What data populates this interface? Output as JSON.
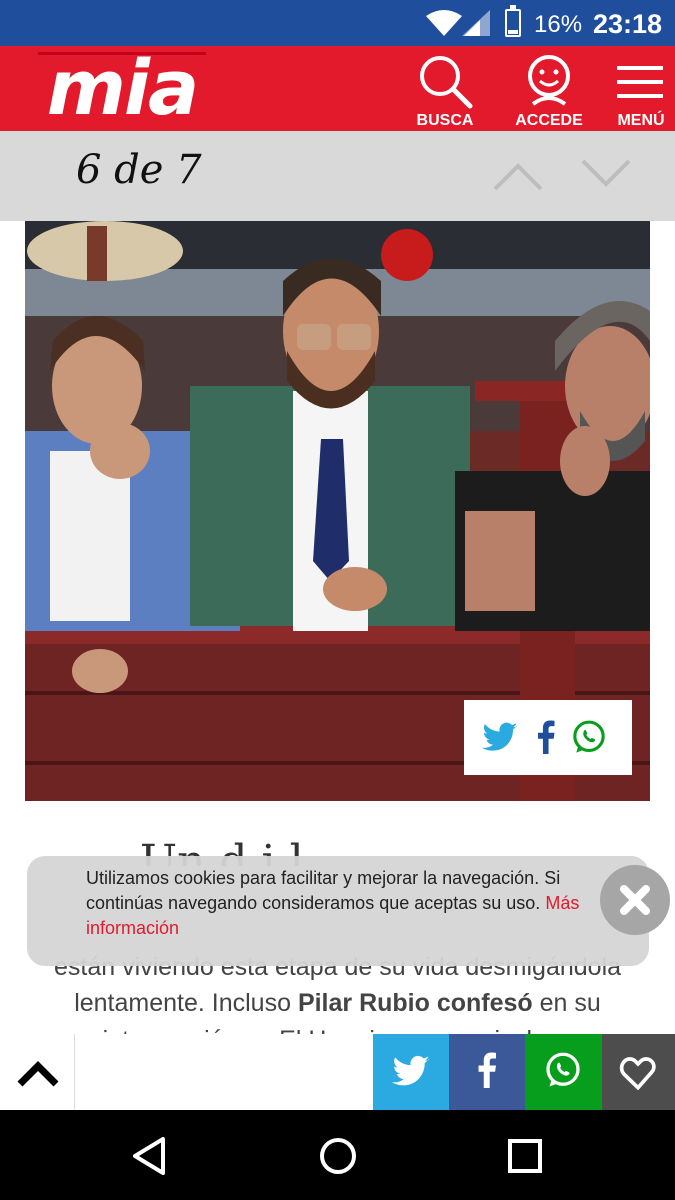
{
  "status": {
    "battery": "16%",
    "time": "23:18"
  },
  "header": {
    "logo": "mia",
    "search_label": "BUSCA",
    "login_label": "ACCEDE",
    "menu_label": "MENÚ"
  },
  "pager": {
    "position": "6 de 7"
  },
  "article": {
    "headline_fragment": "Un      d     i    l",
    "line1": "están viviendo esta etapa de su vida desmigándola",
    "line2_a": "lentamente. Incluso ",
    "line2_b": "Pilar Rubio confesó",
    "line2_c": " en su",
    "line3": "intervención en El Hormiguero que incluso"
  },
  "cookie": {
    "text": "Utilizamos cookies para facilitar y mejorar la navegación. Si continúas navegando consideramos que aceptas su uso.",
    "more": "Más información"
  },
  "colors": {
    "brand_red": "#e21a2c",
    "status_blue": "#1f4e9c",
    "twitter": "#2ba9e1",
    "facebook": "#3b5998",
    "whatsapp": "#069e1c"
  }
}
